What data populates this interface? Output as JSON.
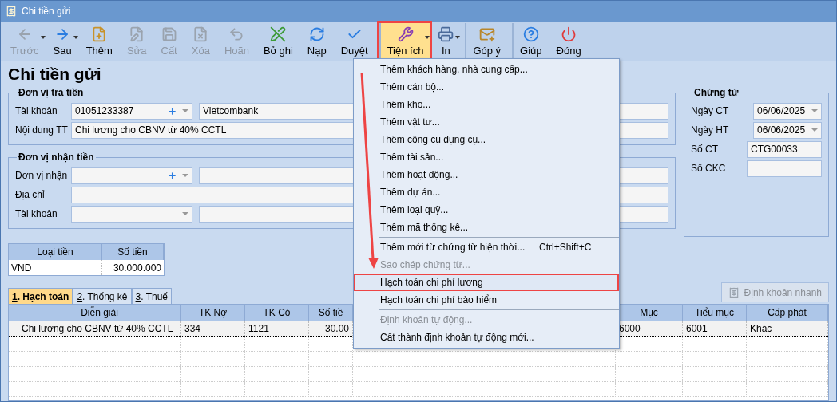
{
  "window": {
    "title": "Chi tiền gửi"
  },
  "toolbar": [
    {
      "kind": "back",
      "label": "Trước",
      "disabled": true,
      "dropdown": true,
      "group_start": false,
      "active": false,
      "highlighted": false
    },
    {
      "kind": "forward",
      "label": "Sau",
      "disabled": false,
      "dropdown": true,
      "group_start": false,
      "active": false,
      "highlighted": false
    },
    {
      "kind": "add",
      "label": "Thêm",
      "disabled": false,
      "dropdown": false,
      "group_start": false,
      "active": false,
      "highlighted": false
    },
    {
      "kind": "edit",
      "label": "Sửa",
      "disabled": true,
      "dropdown": false,
      "group_start": false,
      "active": false,
      "highlighted": false
    },
    {
      "kind": "save",
      "label": "Cất",
      "disabled": true,
      "dropdown": false,
      "group_start": false,
      "active": false,
      "highlighted": false
    },
    {
      "kind": "delete",
      "label": "Xóa",
      "disabled": true,
      "dropdown": false,
      "group_start": false,
      "active": false,
      "highlighted": false
    },
    {
      "kind": "undo",
      "label": "Hoãn",
      "disabled": true,
      "dropdown": false,
      "group_start": false,
      "active": false,
      "highlighted": false
    },
    {
      "kind": "unpost",
      "label": "Bỏ ghi",
      "disabled": false,
      "dropdown": false,
      "group_start": false,
      "active": false,
      "highlighted": false
    },
    {
      "kind": "reload",
      "label": "Nạp",
      "disabled": false,
      "dropdown": false,
      "group_start": false,
      "active": false,
      "highlighted": false
    },
    {
      "kind": "approve",
      "label": "Duyệt",
      "disabled": false,
      "dropdown": false,
      "group_start": false,
      "active": false,
      "highlighted": false
    },
    {
      "kind": "tools",
      "label": "Tiện ích",
      "disabled": false,
      "dropdown": true,
      "group_start": true,
      "active": true,
      "highlighted": true
    },
    {
      "kind": "print",
      "label": "In",
      "disabled": false,
      "dropdown": true,
      "group_start": false,
      "active": false,
      "highlighted": false
    },
    {
      "kind": "feedback",
      "label": "Góp ý",
      "disabled": false,
      "dropdown": false,
      "group_start": true,
      "active": false,
      "highlighted": false
    },
    {
      "kind": "help",
      "label": "Giúp",
      "disabled": false,
      "dropdown": false,
      "group_start": true,
      "active": false,
      "highlighted": false
    },
    {
      "kind": "close",
      "label": "Đóng",
      "disabled": false,
      "dropdown": false,
      "group_start": false,
      "active": false,
      "highlighted": false
    }
  ],
  "heading": "Chi tiền gửi",
  "payer": {
    "legend": "Đơn vị trả tiền",
    "rows": [
      {
        "kind": "combo_pair",
        "label": "Tài khoản",
        "value": "01051233387",
        "extra": "Vietcombank",
        "add_button": true
      },
      {
        "kind": "text",
        "label": "Nội dung TT",
        "value": "Chi lương cho CBNV từ 40% CCTL"
      }
    ]
  },
  "payee": {
    "legend": "Đơn vị nhận tiền",
    "rows": [
      {
        "kind": "combo_pair",
        "label": "Đơn vị nhận",
        "add_button": true
      },
      {
        "kind": "text",
        "label": "Địa chỉ"
      },
      {
        "kind": "combo_pair",
        "label": "Tài khoản",
        "add_button": false
      }
    ]
  },
  "voucher": {
    "legend": "Chứng từ",
    "rows": [
      {
        "kind": "date",
        "label": "Ngày CT",
        "value": "06/06/2025"
      },
      {
        "kind": "date",
        "label": "Ngày HT",
        "value": "06/06/2025"
      },
      {
        "kind": "text",
        "label": "Số CT",
        "value": "CTG00033"
      },
      {
        "kind": "text",
        "label": "Số CKC"
      }
    ]
  },
  "currency_table": {
    "columns": [
      "Loại tiền",
      "Số tiền"
    ],
    "rows": [
      [
        "VND",
        "30.000.000"
      ]
    ]
  },
  "tabs": [
    {
      "label": "1. Hạch toán",
      "selected": true
    },
    {
      "label": "2. Thống kê",
      "selected": false
    },
    {
      "label": "3. Thuế",
      "selected": false
    }
  ],
  "quick_button": {
    "label": "Định khoản nhanh",
    "disabled": true
  },
  "grid": {
    "columns": [
      "Diễn giải",
      "TK Nợ",
      "TK Có",
      "Số tiề",
      "Mục",
      "Tiểu mục",
      "Cấp phát"
    ],
    "rows": [
      [
        "Chi lương cho CBNV từ 40% CCTL",
        "334",
        "1121",
        "30.00",
        "6000",
        "6001",
        "Khác"
      ]
    ]
  },
  "menu": {
    "items": [
      {
        "kind": "item",
        "label": "Thêm khách hàng, nhà cung cấp...",
        "disabled": false,
        "highlighted": false
      },
      {
        "kind": "item",
        "label": "Thêm cán bộ...",
        "disabled": false,
        "highlighted": false
      },
      {
        "kind": "item",
        "label": "Thêm kho...",
        "disabled": false,
        "highlighted": false
      },
      {
        "kind": "item",
        "label": "Thêm vật tư...",
        "disabled": false,
        "highlighted": false
      },
      {
        "kind": "item",
        "label": "Thêm công cụ dụng cụ...",
        "disabled": false,
        "highlighted": false
      },
      {
        "kind": "item",
        "label": "Thêm tài sản...",
        "disabled": false,
        "highlighted": false
      },
      {
        "kind": "item",
        "label": "Thêm hoạt động...",
        "disabled": false,
        "highlighted": false
      },
      {
        "kind": "item",
        "label": "Thêm dự án...",
        "disabled": false,
        "highlighted": false
      },
      {
        "kind": "item",
        "label": "Thêm loại quỹ...",
        "disabled": false,
        "highlighted": false
      },
      {
        "kind": "item",
        "label": "Thêm mã thống kê...",
        "disabled": false,
        "highlighted": false
      },
      {
        "kind": "separator"
      },
      {
        "kind": "item",
        "label": "Thêm mới từ chứng từ hiện thời...",
        "shortcut": "Ctrl+Shift+C",
        "disabled": false,
        "highlighted": false
      },
      {
        "kind": "item",
        "label": "Sao chép chứng từ...",
        "disabled": true,
        "highlighted": false
      },
      {
        "kind": "item",
        "label": "Hạch toán chi phí lương",
        "disabled": false,
        "highlighted": true
      },
      {
        "kind": "item",
        "label": "Hạch toán chi phí bảo hiểm",
        "disabled": false,
        "highlighted": false
      },
      {
        "kind": "separator"
      },
      {
        "kind": "item",
        "label": "Định khoản tự động...",
        "disabled": true,
        "highlighted": false
      },
      {
        "kind": "item",
        "label": "Cất thành định khoản tự động mới...",
        "disabled": false,
        "highlighted": false
      }
    ]
  }
}
